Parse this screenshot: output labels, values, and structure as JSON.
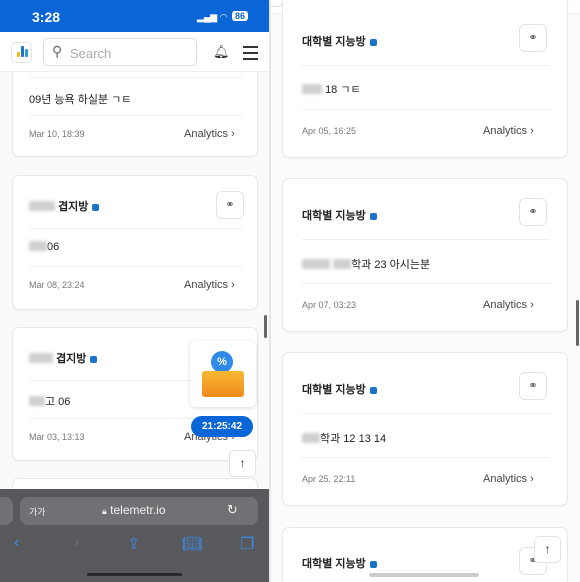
{
  "left": {
    "status": {
      "time": "3:28",
      "battery": "86"
    },
    "header": {
      "search_placeholder": "Search"
    },
    "cards": [
      {
        "title": "",
        "body": "09년 능욕 하실분 ㄱㅌ",
        "date": "Mar 10, 18:39",
        "analytics": "Analytics"
      },
      {
        "title": "겹지방",
        "body": "06",
        "date": "Mar 08, 23:24",
        "analytics": "Analytics"
      },
      {
        "title": "겹지방",
        "body": "고 06",
        "date": "Mar 03, 13:13",
        "analytics": "Analytics"
      }
    ],
    "timer": "21:25:42",
    "browser": {
      "text_size": "가가",
      "url": "telemetr.io"
    }
  },
  "right": {
    "cards": [
      {
        "title": "대학별 지능방",
        "body": "18 ㄱㅌ",
        "date": "Apr 05, 16:25",
        "analytics": "Analytics"
      },
      {
        "title": "대학별 지능방",
        "body": "학과 23 아시는분",
        "date": "Apr 07, 03:23",
        "analytics": "Analytics"
      },
      {
        "title": "대학별 지능방",
        "body": "학과 12 13 14",
        "date": "Apr 25, 22:11",
        "analytics": "Analytics"
      },
      {
        "title": "대학별 지능방"
      }
    ]
  },
  "colors": {
    "brand": "#0a66d6",
    "bot_icon": "#1a73c8"
  }
}
